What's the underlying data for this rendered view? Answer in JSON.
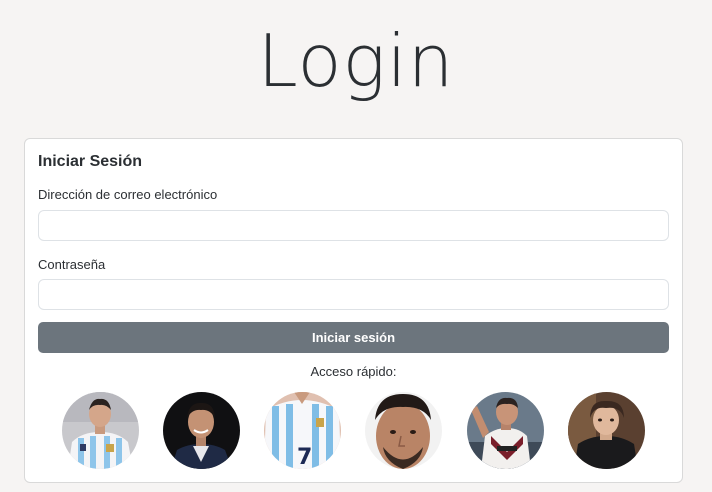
{
  "page": {
    "title": "Login"
  },
  "login_card": {
    "heading": "Iniciar Sesión",
    "email_label": "Dirección de correo electrónico",
    "email_value": "",
    "password_label": "Contraseña",
    "password_value": "",
    "submit_label": "Iniciar sesión",
    "quick_access_label": "Acceso rápido:"
  },
  "quick_access_avatars": [
    {
      "kind": "player-photo",
      "jersey": "argentina-stripes",
      "background": "#c8c8cc"
    },
    {
      "kind": "player-photo",
      "jersey": "navy-white",
      "background": "#101010"
    },
    {
      "kind": "player-photo",
      "jersey": "argentina-stripes-number",
      "background": "#e0c0b0"
    },
    {
      "kind": "player-photo",
      "jersey": "none-closeup",
      "background": "#f2f2f2"
    },
    {
      "kind": "player-photo",
      "jersey": "lanus-maroon-white",
      "background": "#6a7a8a"
    },
    {
      "kind": "player-photo",
      "jersey": "dark-hoodie",
      "background": "#5a4030"
    }
  ],
  "colors": {
    "page_background": "#f6f4f3",
    "submit_button": "#6c757d",
    "card_border": "#d9d9d9"
  }
}
